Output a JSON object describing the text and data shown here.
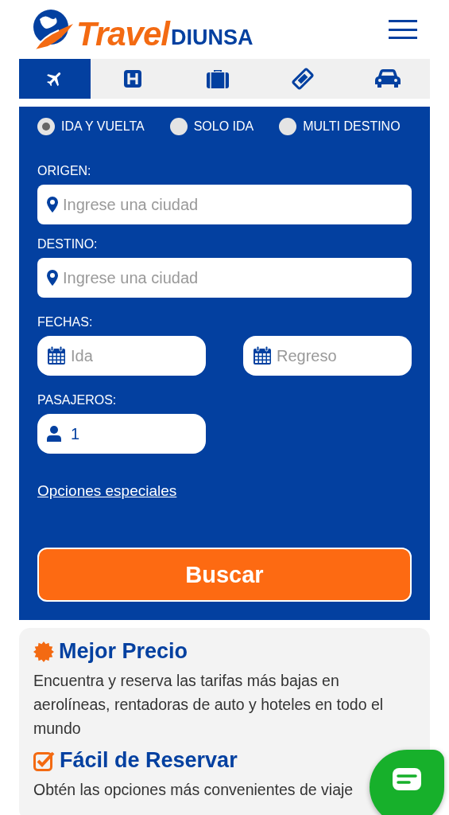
{
  "header": {
    "logo": {
      "brand": "Travel",
      "sub": "DIUNSA"
    }
  },
  "tabs": [
    {
      "kind": "plane",
      "selected": true
    },
    {
      "kind": "hotel",
      "selected": false
    },
    {
      "kind": "suitcase",
      "selected": false
    },
    {
      "kind": "ticket",
      "selected": false
    },
    {
      "kind": "car",
      "selected": false
    }
  ],
  "trip_types": [
    {
      "label": "IDA Y VUELTA",
      "selected": true
    },
    {
      "label": "SOLO IDA",
      "selected": false
    },
    {
      "label": "MULTI DESTINO",
      "selected": false
    }
  ],
  "origin": {
    "label": "ORIGEN:",
    "placeholder": "Ingrese una ciudad"
  },
  "destination": {
    "label": "DESTINO:",
    "placeholder": "Ingrese una ciudad"
  },
  "dates": {
    "label": "FECHAS:",
    "fields": [
      {
        "placeholder": "Ida"
      },
      {
        "placeholder": "Regreso"
      }
    ]
  },
  "passengers": {
    "label": "PASAJEROS:",
    "value": "1"
  },
  "special_options_link": "Opciones especiales",
  "search_button": "Buscar",
  "features": [
    {
      "kind": "badge",
      "title": "Mejor Precio",
      "text": "Encuentra y reserva las tarifas más bajas en aerolíneas, rentadoras de auto y hoteles en todo el mundo"
    },
    {
      "kind": "check",
      "title": "Fácil de Reservar",
      "text": "Obtén las opciones más convenientes de viaje"
    }
  ]
}
